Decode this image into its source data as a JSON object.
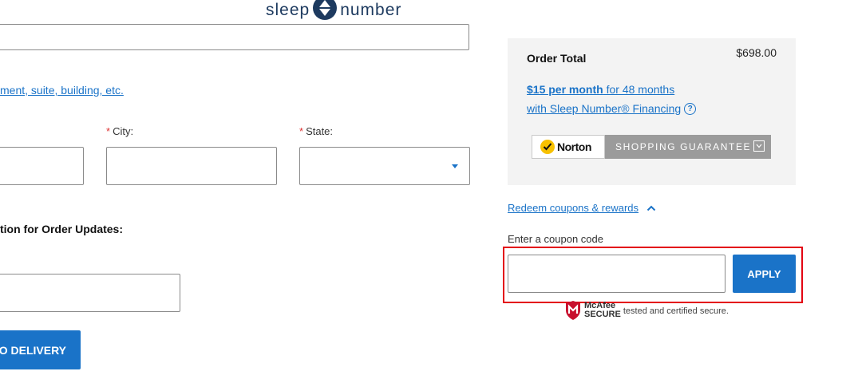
{
  "header": {
    "logo_left": "sleep",
    "logo_right": "number"
  },
  "address": {
    "line2_link": "ment, suite, building, etc."
  },
  "fields": {
    "city_label": "City:",
    "state_label": "State:",
    "required_mark": "*"
  },
  "notifications": {
    "section_title": "tion for Order Updates:"
  },
  "actions": {
    "continue_label": "O DELIVERY"
  },
  "summary": {
    "order_total_label": "Order Total",
    "order_total_value": "$698.00",
    "financing_amount": "$15 per month",
    "financing_term": " for 48 months",
    "financing_line2": "with Sleep Number® Financing",
    "help_glyph": "?"
  },
  "norton": {
    "brand": "Norton",
    "guarantee": "SHOPPING GUARANTEE"
  },
  "coupon": {
    "redeem_link": "Redeem coupons & rewards",
    "input_label": "Enter a coupon code",
    "input_value": "",
    "input_placeholder": "",
    "apply_label": "APPLY"
  },
  "security": {
    "badge_line1": "McAfee",
    "badge_line2": "SECURE",
    "caption": "tested and certified secure."
  },
  "colors": {
    "accent": "#1a73c8",
    "brand_navy": "#1d3a5f",
    "highlight": "#e30613",
    "summary_bg": "#f3f3f3"
  },
  "icons": [
    "sleep-number-logo-icon",
    "chevron-down-icon",
    "help-icon",
    "norton-check-icon",
    "chevron-up-icon",
    "mcafee-shield-icon"
  ]
}
